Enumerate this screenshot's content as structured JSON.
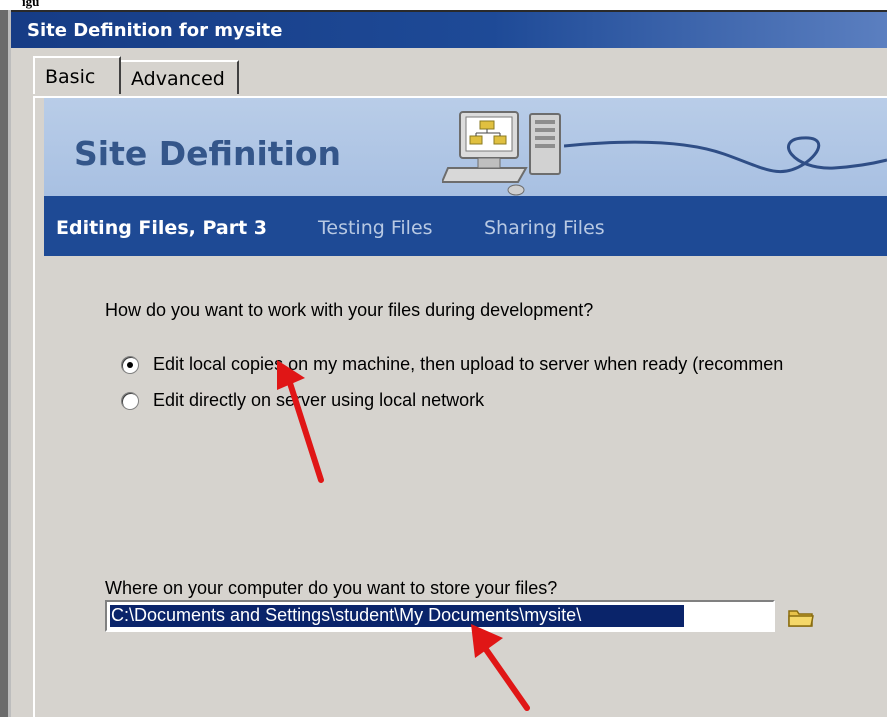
{
  "doc": {
    "fragment": "igu"
  },
  "window": {
    "title": "Site Definition for mysite"
  },
  "tabs": [
    {
      "label": "Basic",
      "active": true
    },
    {
      "label": "Advanced",
      "active": false
    }
  ],
  "header": {
    "title": "Site Definition"
  },
  "steps": [
    {
      "label": "Editing Files, Part 3",
      "active": true
    },
    {
      "label": "Testing Files",
      "active": false
    },
    {
      "label": "Sharing Files",
      "active": false
    }
  ],
  "workflow": {
    "question": "How do you want to work with your files during development?",
    "options": [
      {
        "label": "Edit local copies on my machine, then upload to server when ready (recommen",
        "selected": true
      },
      {
        "label": "Edit directly on server using local network",
        "selected": false
      }
    ]
  },
  "storage": {
    "question": "Where on your computer do you want to store your files?",
    "path": "C:\\Documents and Settings\\student\\My Documents\\mysite\\"
  },
  "colors": {
    "title_bar": "#1e4a97",
    "header_band": "#a8c0e2",
    "nav_band": "#1e4a95",
    "annotation_arrow": "#e01616"
  }
}
